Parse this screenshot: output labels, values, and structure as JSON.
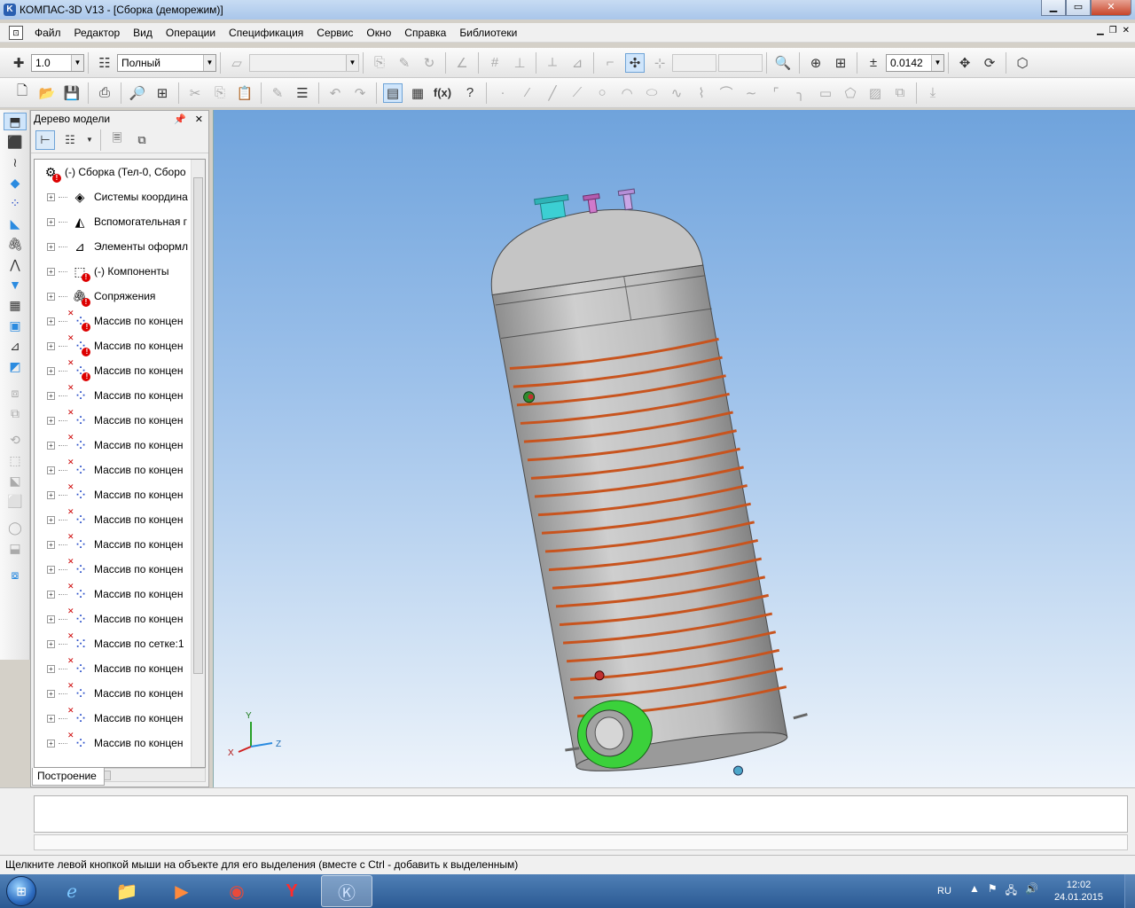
{
  "window": {
    "title": "КОМПАС-3D V13 - [Сборка (деморежим)]"
  },
  "menu": [
    "Файл",
    "Редактор",
    "Вид",
    "Операции",
    "Спецификация",
    "Сервис",
    "Окно",
    "Справка",
    "Библиотеки"
  ],
  "toolbar": {
    "step_value": "1.0",
    "render_mode": "Полный",
    "scale_value": "0.0142"
  },
  "tree": {
    "title": "Дерево модели",
    "tab_label": "Построение",
    "root": "(-) Сборка (Тел-0, Сборо",
    "items": [
      {
        "label": "Системы координа",
        "icon": "cube-icon",
        "error": false
      },
      {
        "label": "Вспомогательная г",
        "icon": "plane-icon",
        "error": false
      },
      {
        "label": "Элементы оформл",
        "icon": "annotation-icon",
        "error": false
      },
      {
        "label": "(-) Компоненты",
        "icon": "components-icon",
        "error": true
      },
      {
        "label": "Сопряжения",
        "icon": "mates-icon",
        "error": true
      },
      {
        "label": "Массив по концен",
        "icon": "array-icon",
        "error": true
      },
      {
        "label": "Массив по концен",
        "icon": "array-icon",
        "error": true
      },
      {
        "label": "Массив по концен",
        "icon": "array-icon",
        "error": true
      },
      {
        "label": "Массив по концен",
        "icon": "array-icon",
        "error": false
      },
      {
        "label": "Массив по концен",
        "icon": "array-icon",
        "error": false
      },
      {
        "label": "Массив по концен",
        "icon": "array-icon",
        "error": false
      },
      {
        "label": "Массив по концен",
        "icon": "array-icon",
        "error": false
      },
      {
        "label": "Массив по концен",
        "icon": "array-icon",
        "error": false
      },
      {
        "label": "Массив по концен",
        "icon": "array-icon",
        "error": false
      },
      {
        "label": "Массив по концен",
        "icon": "array-icon",
        "error": false
      },
      {
        "label": "Массив по концен",
        "icon": "array-icon",
        "error": false
      },
      {
        "label": "Массив по концен",
        "icon": "array-icon",
        "error": false
      },
      {
        "label": "Массив по концен",
        "icon": "array-icon",
        "error": false
      },
      {
        "label": "Массив по сетке:1",
        "icon": "grid-array-icon",
        "error": false
      },
      {
        "label": "Массив по концен",
        "icon": "array-icon",
        "error": false
      },
      {
        "label": "Массив по концен",
        "icon": "array-icon",
        "error": false
      },
      {
        "label": "Массив по концен",
        "icon": "array-icon",
        "error": false
      },
      {
        "label": "Массив по концен",
        "icon": "array-icon",
        "error": false
      }
    ]
  },
  "axes": {
    "x": "X",
    "y": "Y",
    "z": "Z"
  },
  "status_text": "Щелкните левой кнопкой мыши на объекте для его выделения (вместе с Ctrl - добавить к выделенным)",
  "tray": {
    "language": "RU",
    "time": "12:02",
    "date": "24.01.2015"
  },
  "colors": {
    "viewport_top": "#6fa3dc",
    "viewport_bottom": "#eef4fb",
    "tank_body": "#b9b9b9",
    "coil": "#c8541e",
    "flange": "#3bd13b"
  }
}
